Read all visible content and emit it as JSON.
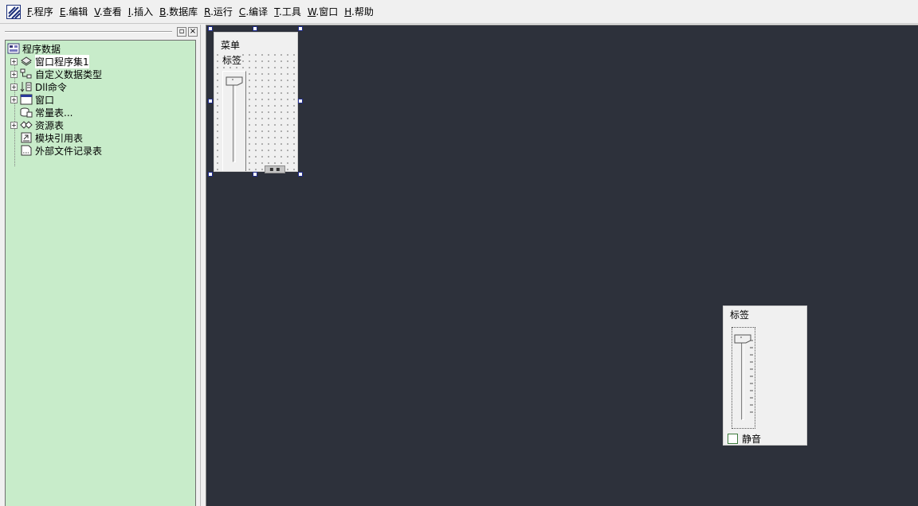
{
  "menubar": {
    "items": [
      {
        "key": "F",
        "label": ".程序"
      },
      {
        "key": "E",
        "label": ".编辑"
      },
      {
        "key": "V",
        "label": ".查看"
      },
      {
        "key": "I",
        "label": ".插入"
      },
      {
        "key": "B",
        "label": ".数据库"
      },
      {
        "key": "R",
        "label": ".运行"
      },
      {
        "key": "C",
        "label": ".编译"
      },
      {
        "key": "T",
        "label": ".工具"
      },
      {
        "key": "W",
        "label": ".窗口"
      },
      {
        "key": "H",
        "label": ".帮助"
      }
    ]
  },
  "panel": {
    "restore_icon": "restore-icon",
    "close_icon": "close-icon"
  },
  "tree": {
    "root": "程序数据",
    "items": [
      {
        "label": "窗口程序集1",
        "expandable": true,
        "icon": "assembly-icon"
      },
      {
        "label": "自定义数据类型",
        "expandable": true,
        "icon": "datatype-icon"
      },
      {
        "label": "Dll命令",
        "expandable": true,
        "icon": "dll-icon"
      },
      {
        "label": "窗口",
        "expandable": true,
        "icon": "window-icon"
      },
      {
        "label": "常量表...",
        "expandable": false,
        "icon": "constants-icon"
      },
      {
        "label": "资源表",
        "expandable": true,
        "icon": "resources-icon"
      },
      {
        "label": "模块引用表",
        "expandable": false,
        "icon": "module-ref-icon"
      },
      {
        "label": "外部文件记录表",
        "expandable": false,
        "icon": "external-file-icon"
      }
    ]
  },
  "designer": {
    "menu_label": "菜单",
    "label_text": "标签"
  },
  "preview": {
    "label_text": "标签",
    "checkbox_label": "静音"
  },
  "colors": {
    "workspace_bg": "#2d313b",
    "tree_bg": "#c8ecca",
    "handle_border": "#1f2b8a"
  }
}
